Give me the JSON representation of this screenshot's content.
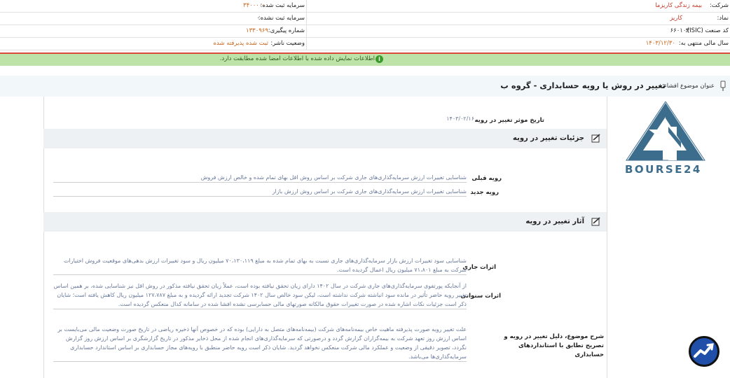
{
  "header": {
    "company_label": "شرکت:",
    "company_value": "بیمه زندگی کاریزما",
    "symbol_label": "نماد:",
    "symbol_value": "کاریز",
    "isic_label": "کد صنعت (ISIC):",
    "isic_value": "۶۶۰۱۰۳",
    "fiscal_label": "سال مالی منتهی به:",
    "fiscal_value": "۱۴۰۳/۱۲/۳۰",
    "capital_reg_label": "سرمایه ثبت شده:",
    "capital_reg_value": "۳۴۰۰۰۰۰",
    "capital_unreg_label": "سرمایه ثبت نشده:",
    "capital_unreg_value": "۰",
    "tracking_label": "شماره پیگیری:",
    "tracking_value": "۱۳۳۰۹۶۹",
    "status_label": "وضعیت ناشر:",
    "status_value": "ثبت شده پذیرفته شده"
  },
  "notice": {
    "text": "اطلاعات نمایش داده شده با اطلاعات امضا شده مطابقت دارد."
  },
  "title": {
    "prefix": "عنوان موضوع افشاء:",
    "main": "تغییر در روش یا رویه حسابداری - گروه ب"
  },
  "effective_date": {
    "label": "تاریخ موثر تغییر در رویه",
    "value": "۱۴۰۳/۰۲/۱۶"
  },
  "section1": {
    "title": "جزئیات تغییر در رویه",
    "prev_label": "رویه قبلی",
    "prev_value": "شناسایی تغییرات ارزش سرمایه‌گذاری‌های جاری شرکت بر اساس روش اقل بهای تمام شده و خالص ارزش فروش",
    "new_label": "رویه جدید",
    "new_value": "شناسایی تغییرات ارزش سرمایه‌گذاری‌های جاری شرکت بر اساس روش ارزش بازار"
  },
  "section2": {
    "title": "آثار تغییر در رویه",
    "current_label": "اثرات جاری",
    "current_value": "شناسایی سود تغییرات ارزش بازار سرمایه‌گذاری‌های جاری نسبت به بهای تمام شده به مبلغ ۷۰،۱۳۰،۱۱۹ میلیون ریال و سود تغییرات ارزش بدهی‌های موقعیت فروش اختیارات شرکت به مبلغ ۷۱،۸۰۱ میلیون ریال اعمال گردیده است.",
    "prior_label": "اثرات سنواتی",
    "prior_value": "از آنجایکه پورتفوی سرمایه‌گذاری‌های جاری شرکت در سال ۱۴۰۲ دارای زیان تحقق نیافته بوده است، عملاً زیان تحقق نیافته مذکور در روش اقل نیز شناسایی شده، بر همین اساس تغییر رویه حاضر تأثیر در مانده سود انباشته شرکت نداشته است، لیکن سود خالص سال ۱۴۰۲ شرکت تجدید ارائه گردیده و به مبلغ ۱۲۷،۷۸۷ میلیون ریال کاهش یافته است؛ شایان ذکر است جزئیات نکات اشاره شده در صورت تغییرات حقوق مالکانه صورتهای مالی حسابرسی نشده افشا شده در سامانه کدال منعکس گردیده است.",
    "reason_label": "شرح موضوع، دلیل تغییر در رویه و تصریح تطابق با استانداردهای حسابداری",
    "reason_value": "علت تغییر رویه صورت پذیرفته ماهیت خاص بیمه‌نامه‌های شرکت (بیمه‌نامه‌های متصل به دارایی) بوده که در خصوص آنها ذخیره ریاضی در تاریخ صورت وضعیت مالی می‌بایست بر اساس ارزش روز تعهد شرکت به بیمه‌گزاران گزارش گردد و درصورتی که سرمایه‌گذاری‌های انجام شده از محل ذخایر مذکور در تاریخ گزارشگری بر اساس ارزش روز گزارش نگردد، تصویر دقیقی از وضعیت و عملکرد مالی شرکت منعکس نخواهد گردید. شایان ذکر است رویه حاضر منطبق با رویه‌های مجاز حسابداری بر اساس استاندارد حسابداری سرمایه‌گذاری‌ها می‌باشد."
  },
  "logo": {
    "text": "BOURSE24",
    "color": "#3d6d8c"
  }
}
